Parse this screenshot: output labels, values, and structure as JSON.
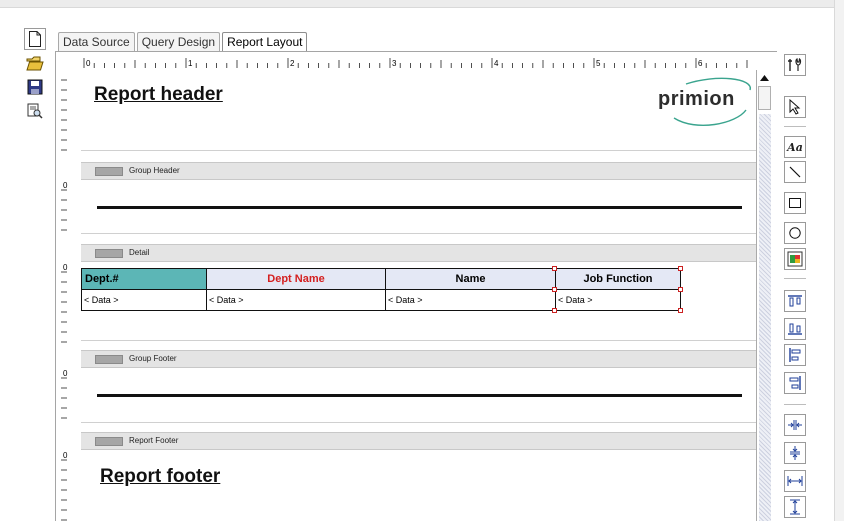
{
  "tabs": [
    {
      "label": "Data Source",
      "active": false
    },
    {
      "label": "Query Design",
      "active": false
    },
    {
      "label": "Report Layout",
      "active": true
    }
  ],
  "ruler": {
    "numbers": [
      "0",
      "1",
      "2",
      "3",
      "4",
      "5",
      "6"
    ],
    "left_numbers": [
      "0",
      "0",
      "0",
      "0"
    ]
  },
  "bands": {
    "report_header": {
      "heading": "Report header"
    },
    "group_header": {
      "label": "Group Header"
    },
    "detail": {
      "label": "Detail"
    },
    "group_footer": {
      "label": "Group Footer"
    },
    "report_footer": {
      "label": "Report Footer",
      "heading": "Report footer"
    }
  },
  "logo": {
    "text": "primion",
    "brand_color": "#3aa48e"
  },
  "table": {
    "headers": [
      "Dept.#",
      "Dept Name",
      "Name",
      "Job Function"
    ],
    "row": [
      "< Data >",
      "< Data >",
      "< Data >",
      "< Data >"
    ],
    "header_colors": {
      "teal": "#5cb6b6",
      "red_text": "#d42020",
      "default_bg": "#e4e8f5"
    }
  },
  "toolbars": {
    "left": [
      "new-document-icon",
      "open-folder-icon",
      "save-icon",
      "print-preview-icon"
    ],
    "right": [
      "tools-icon",
      "select-arrow-icon",
      "text-tool-icon",
      "line-tool-icon",
      "rectangle-tool-icon",
      "ellipse-tool-icon",
      "image-tool-icon",
      "align-top-icon",
      "align-bottom-icon",
      "align-left-icon",
      "align-right-icon",
      "same-width-icon",
      "same-height-icon",
      "horizontal-spacing-icon",
      "vertical-spacing-icon"
    ],
    "text_tool_label": "Aa"
  }
}
